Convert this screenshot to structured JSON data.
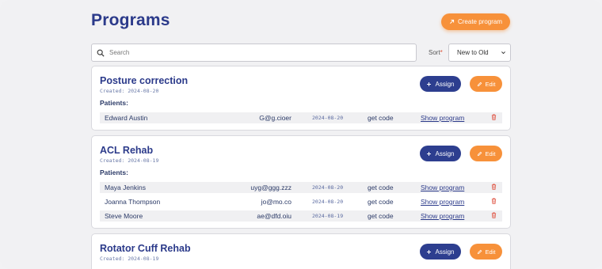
{
  "header": {
    "title": "Programs",
    "create_label": "Create program"
  },
  "search": {
    "placeholder": "Search"
  },
  "sort": {
    "label": "Sort",
    "required_mark": "*",
    "selected": "New to Old"
  },
  "colors": {
    "accent_orange": "#f7913a",
    "navy": "#2d3e8f",
    "delete_red": "#e05a4a"
  },
  "programs": [
    {
      "title": "Posture correction",
      "created": "Created: 2024-08-20",
      "assign_label": "Assign",
      "edit_label": "Edit",
      "patients_label": "Patients:",
      "patients": [
        {
          "name": "Edward Austin",
          "email": "G@g.cioer",
          "date": "2024-08-20",
          "code": "get code",
          "show": "Show program"
        }
      ]
    },
    {
      "title": "ACL Rehab",
      "created": "Created: 2024-08-19",
      "assign_label": "Assign",
      "edit_label": "Edit",
      "patients_label": "Patients:",
      "patients": [
        {
          "name": "Maya Jenkins",
          "email": "uyg@ggg.zzz",
          "date": "2024-08-20",
          "code": "get code",
          "show": "Show program"
        },
        {
          "name": "Joanna Thompson",
          "email": "jo@mo.co",
          "date": "2024-08-20",
          "code": "get code",
          "show": "Show program"
        },
        {
          "name": "Steve Moore",
          "email": "ae@dfd.oiu",
          "date": "2024-08-19",
          "code": "get code",
          "show": "Show program"
        }
      ]
    },
    {
      "title": "Rotator Cuff Rehab",
      "created": "Created: 2024-08-19",
      "assign_label": "Assign",
      "edit_label": "Edit"
    }
  ]
}
